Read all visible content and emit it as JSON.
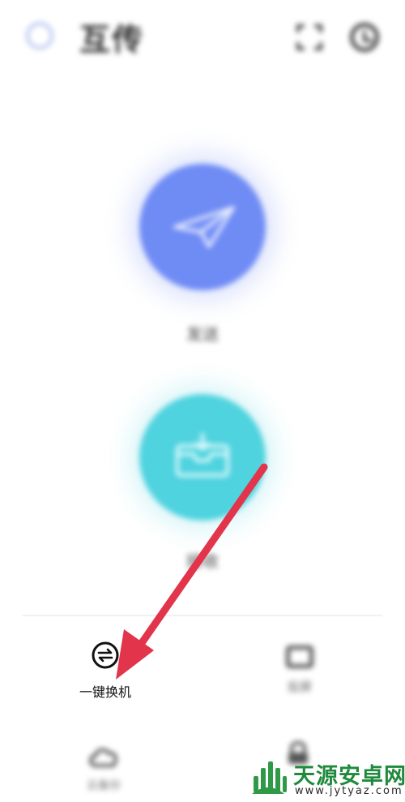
{
  "header": {
    "title": "互传",
    "scan_icon": "scan-icon",
    "history_icon": "history-icon"
  },
  "main": {
    "send": {
      "label": "发送",
      "icon": "paper-plane-icon",
      "color": "#6f8cf5"
    },
    "receive": {
      "label": "接收",
      "icon": "inbox-icon",
      "color": "#4fd3df"
    }
  },
  "tools": [
    {
      "label": "一键换机",
      "icon": "swap-arrows-icon"
    },
    {
      "label": "投屏",
      "icon": "screen-cast-icon"
    },
    {
      "label": "云备份",
      "icon": "cloud-backup-icon"
    },
    {
      "label": "",
      "icon": "lock-icon"
    }
  ],
  "annotation": {
    "color": "#e2344a"
  },
  "watermark": {
    "name": "天源安卓网",
    "url": "www.jytyaz.com"
  }
}
